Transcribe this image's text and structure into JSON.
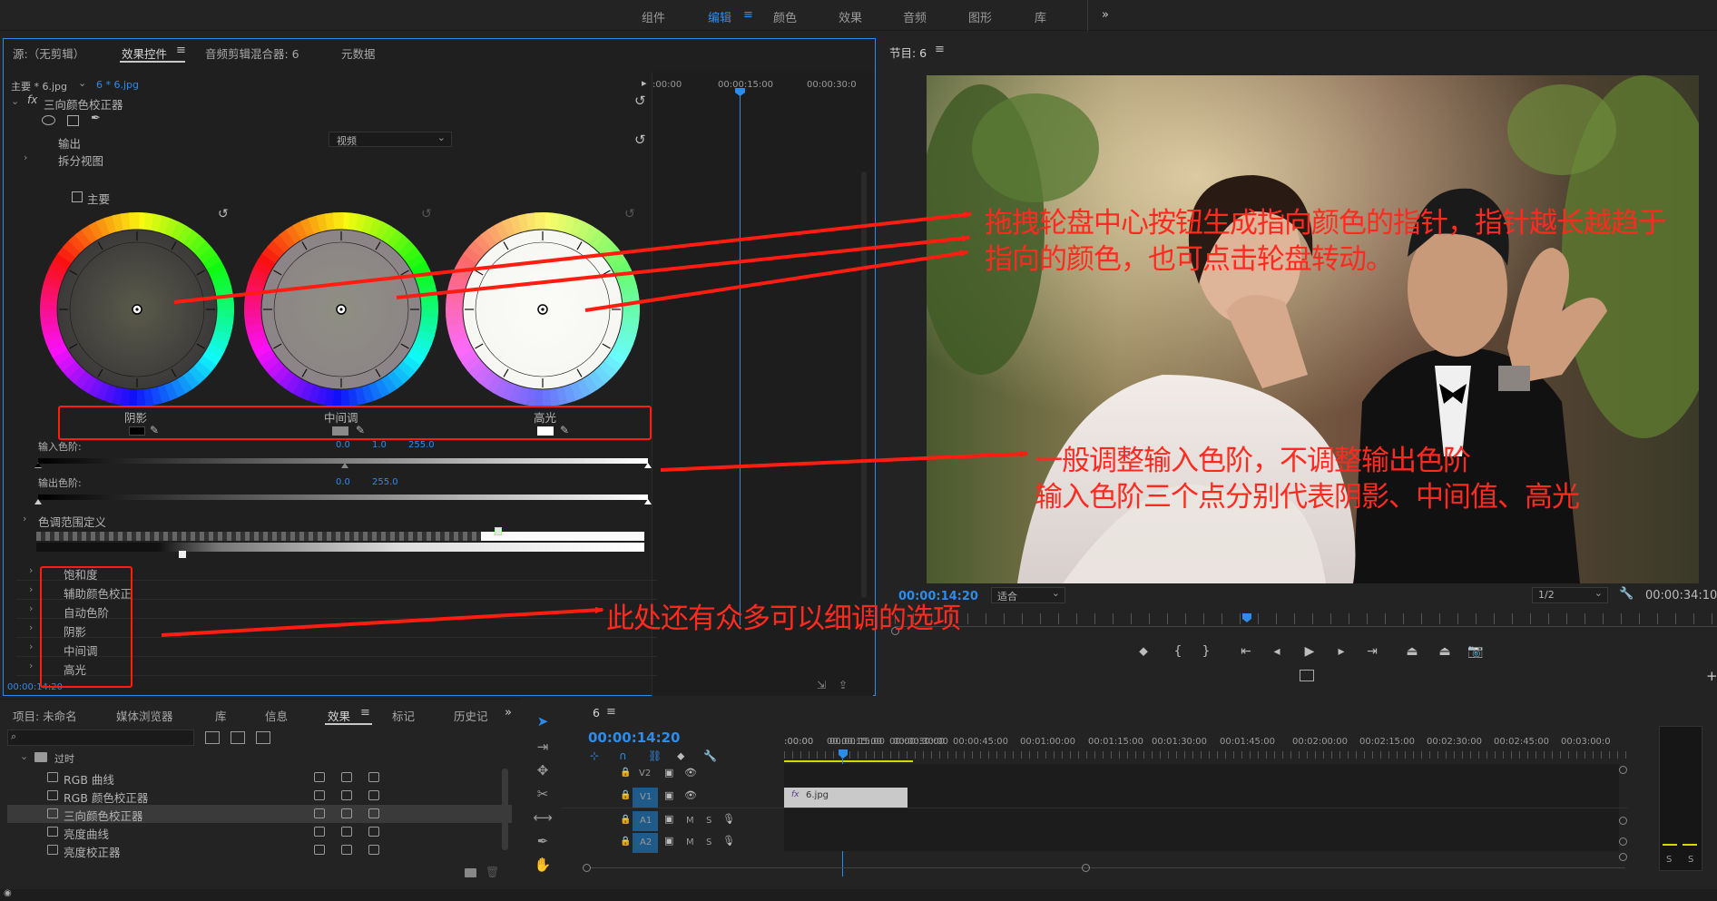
{
  "topbar": {
    "workspaces": [
      "组件",
      "编辑",
      "颜色",
      "效果",
      "音频",
      "图形",
      "库"
    ],
    "active": "编辑",
    "more": "»",
    "menu_icon": "hamburger-icon"
  },
  "effects_panel": {
    "tabs": [
      "源:（无剪辑）",
      "效果控件",
      "音频剪辑混合器: 6",
      "元数据"
    ],
    "active_tab": "效果控件",
    "clip_master": "主要 * 6.jpg",
    "clip_current": "6 * 6.jpg",
    "timecodes": [
      ":00:00",
      "00:00:15:00",
      "00:00:30:0"
    ],
    "effect_name": "三向颜色校正器",
    "output_label": "输出",
    "output_value": "视频",
    "split_view": "拆分视图",
    "master_label": "主要",
    "wheel_labels": [
      "阴影",
      "中间调",
      "高光"
    ],
    "input_levels_label": "输入色阶:",
    "input_levels_values": [
      "0.0",
      "1.0",
      "255.0"
    ],
    "output_levels_label": "输出色阶:",
    "output_levels_values": [
      "0.0",
      "255.0"
    ],
    "tonal_range": "色调范围定义",
    "options": [
      "饱和度",
      "辅助颜色校正",
      "自动色阶",
      "阴影",
      "中间调",
      "高光"
    ],
    "bottom_time": "00:00:14:20"
  },
  "program_panel": {
    "title": "节目: 6",
    "timecode": "00:00:14:20",
    "fit": "适合",
    "resolution": "1/2",
    "duration": "00:00:34:10"
  },
  "project_panel": {
    "tabs": [
      "项目: 未命名",
      "媒体浏览器",
      "库",
      "信息",
      "效果",
      "标记",
      "历史记"
    ],
    "active_tab": "效果",
    "folder": "过时",
    "items": [
      "RGB 曲线",
      "RGB 颜色校正器",
      "三向颜色校正器",
      "亮度曲线",
      "亮度校正器"
    ],
    "selected": "三向颜色校正器"
  },
  "timeline": {
    "title": "6",
    "timecode": "00:00:14:20",
    "ruler": [
      ":00:00",
      "00:00:15:00",
      "00:00:30:00",
      "00:00:45:00",
      "00:01:00:00",
      "00:01:15:00",
      "00:01:30:00",
      "00:01:45:00",
      "00:02:00:00",
      "00:02:15:00",
      "00:02:30:00",
      "00:02:45:00",
      "00:03:00:0"
    ],
    "tracks": [
      "V2",
      "V1",
      "A1",
      "A2"
    ],
    "track_m": "M",
    "track_s": "S",
    "clip_name": "6.jpg",
    "clip_fx": "fx",
    "meter_labels": [
      "S",
      "S"
    ]
  },
  "annotations": {
    "note1_line1": "拖拽轮盘中心按钮生成指向颜色的指针，指针越长越趋于",
    "note1_line2": "指向的颜色，也可点击轮盘转动。",
    "note2_line1": "一般调整输入色阶，不调整输出色阶",
    "note2_line2": "输入色阶三个点分别代表阴影、中间值、高光",
    "note3": "此处还有众多可以细调的选项"
  },
  "colors": {
    "accent": "#2d8ceb",
    "annotation": "#ff1c10",
    "panel": "#232323",
    "panel_border": "#2d8ceb"
  }
}
